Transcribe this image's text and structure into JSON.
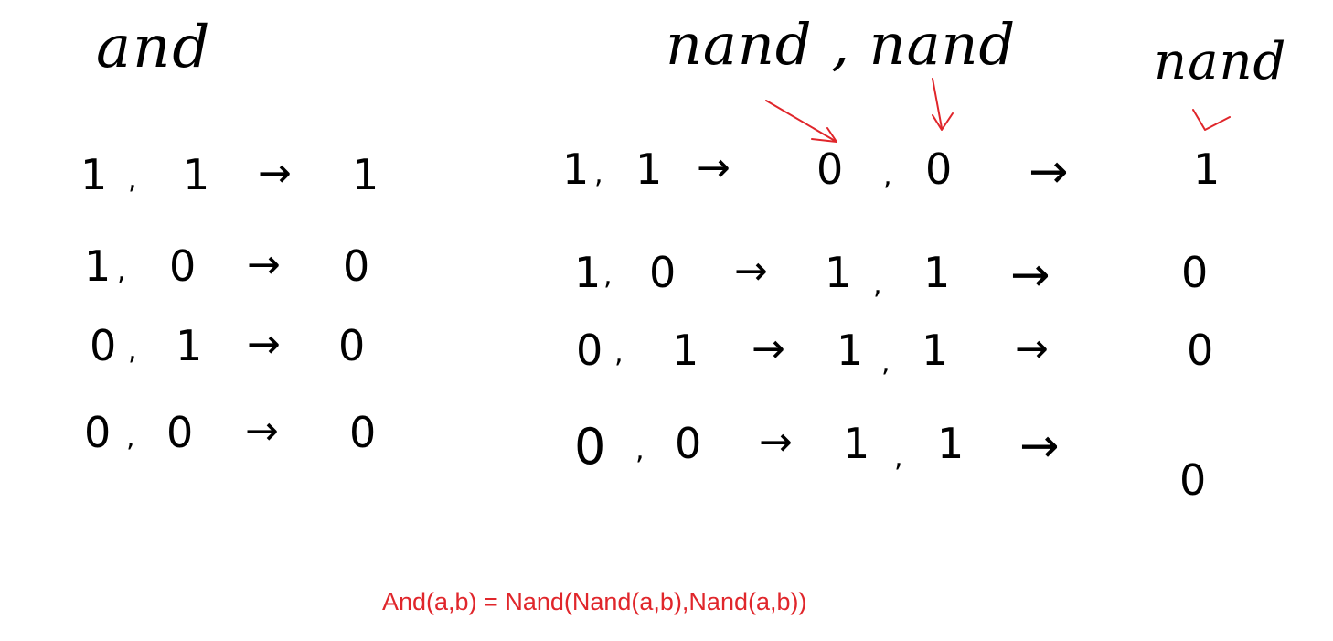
{
  "titles": {
    "left": "and",
    "middle": "nand , nand",
    "right": "nand"
  },
  "left_table": [
    {
      "a": "1",
      "b": "1",
      "out": "1"
    },
    {
      "a": "1",
      "b": "0",
      "out": "0"
    },
    {
      "a": "0",
      "b": "1",
      "out": "0"
    },
    {
      "a": "0",
      "b": "0",
      "out": "0"
    }
  ],
  "right_table": [
    {
      "a": "1",
      "b": "1",
      "n1": "0",
      "n2": "0",
      "out": "1"
    },
    {
      "a": "1",
      "b": "0",
      "n1": "1",
      "n2": "1",
      "out": "0"
    },
    {
      "a": "0",
      "b": "1",
      "n1": "1",
      "n2": "1",
      "out": "0"
    },
    {
      "a": "0",
      "b": "0",
      "n1": "1",
      "n2": "1",
      "out": "0"
    }
  ],
  "separator": ",",
  "arrow": "→",
  "formula": "And(a,b) = Nand(Nand(a,b),Nand(a,b))",
  "colors": {
    "ink": "#000000",
    "annotation": "#e0262b"
  }
}
